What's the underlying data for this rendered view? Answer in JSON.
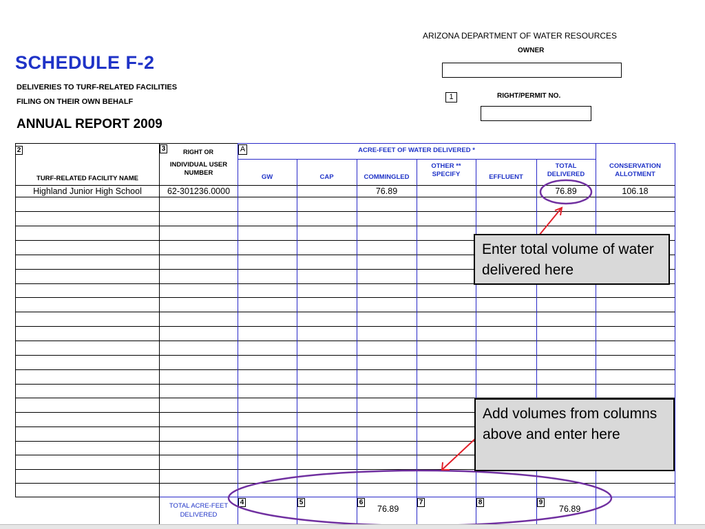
{
  "header": {
    "title": "SCHEDULE  F-2",
    "subtitle_line1": "DELIVERIES TO TURF-RELATED FACILITIES",
    "subtitle_line2": "FILING ON THEIR OWN BEHALF",
    "annual_report": "ANNUAL REPORT  2009",
    "department": "ARIZONA DEPARTMENT OF WATER RESOURCES",
    "owner_label": "OWNER",
    "box1_number": "1",
    "right_permit_label": "RIGHT/PERMIT NO."
  },
  "table": {
    "col_numbers": {
      "facility": "2",
      "right": "3",
      "acre_feet": "A"
    },
    "headers": {
      "facility_name": "TURF-RELATED FACILITY NAME",
      "right_line1": "RIGHT OR",
      "right_line2": "INDIVIDUAL USER",
      "right_line3": "NUMBER",
      "acre_feet_group": "ACRE-FEET OF WATER DELIVERED *",
      "gw": "GW",
      "cap": "CAP",
      "commingled": "COMMINGLED",
      "other_line1": "OTHER **",
      "other_line2": "SPECIFY",
      "effluent": "EFFLUENT",
      "total_line1": "TOTAL",
      "total_line2": "DELIVERED",
      "conservation_line1": "CONSERVATION",
      "conservation_line2": "ALLOTMENT"
    },
    "rows": [
      {
        "facility": "Highland Junior High School",
        "right_number": "62-301236.0000",
        "commingled": "76.89",
        "total_delivered": "76.89",
        "conservation_allotment": "106.18"
      }
    ],
    "totals": {
      "label_line1": "TOTAL ACRE-FEET",
      "label_line2": "DELIVERED",
      "box_numbers": [
        "4",
        "5",
        "6",
        "7",
        "8",
        "9"
      ],
      "commingled_total": "76.89",
      "delivered_total": "76.89"
    }
  },
  "callouts": {
    "total_volume": "Enter total volume of water delivered here",
    "add_volumes": "Add volumes from columns above and enter here"
  },
  "colors": {
    "title": "#1f33c7",
    "grid_blue": "#2828c8",
    "annotation_oval": "#7030a0",
    "annotation_arrow": "#e0202a",
    "callout_fill": "#d9d9d9"
  }
}
